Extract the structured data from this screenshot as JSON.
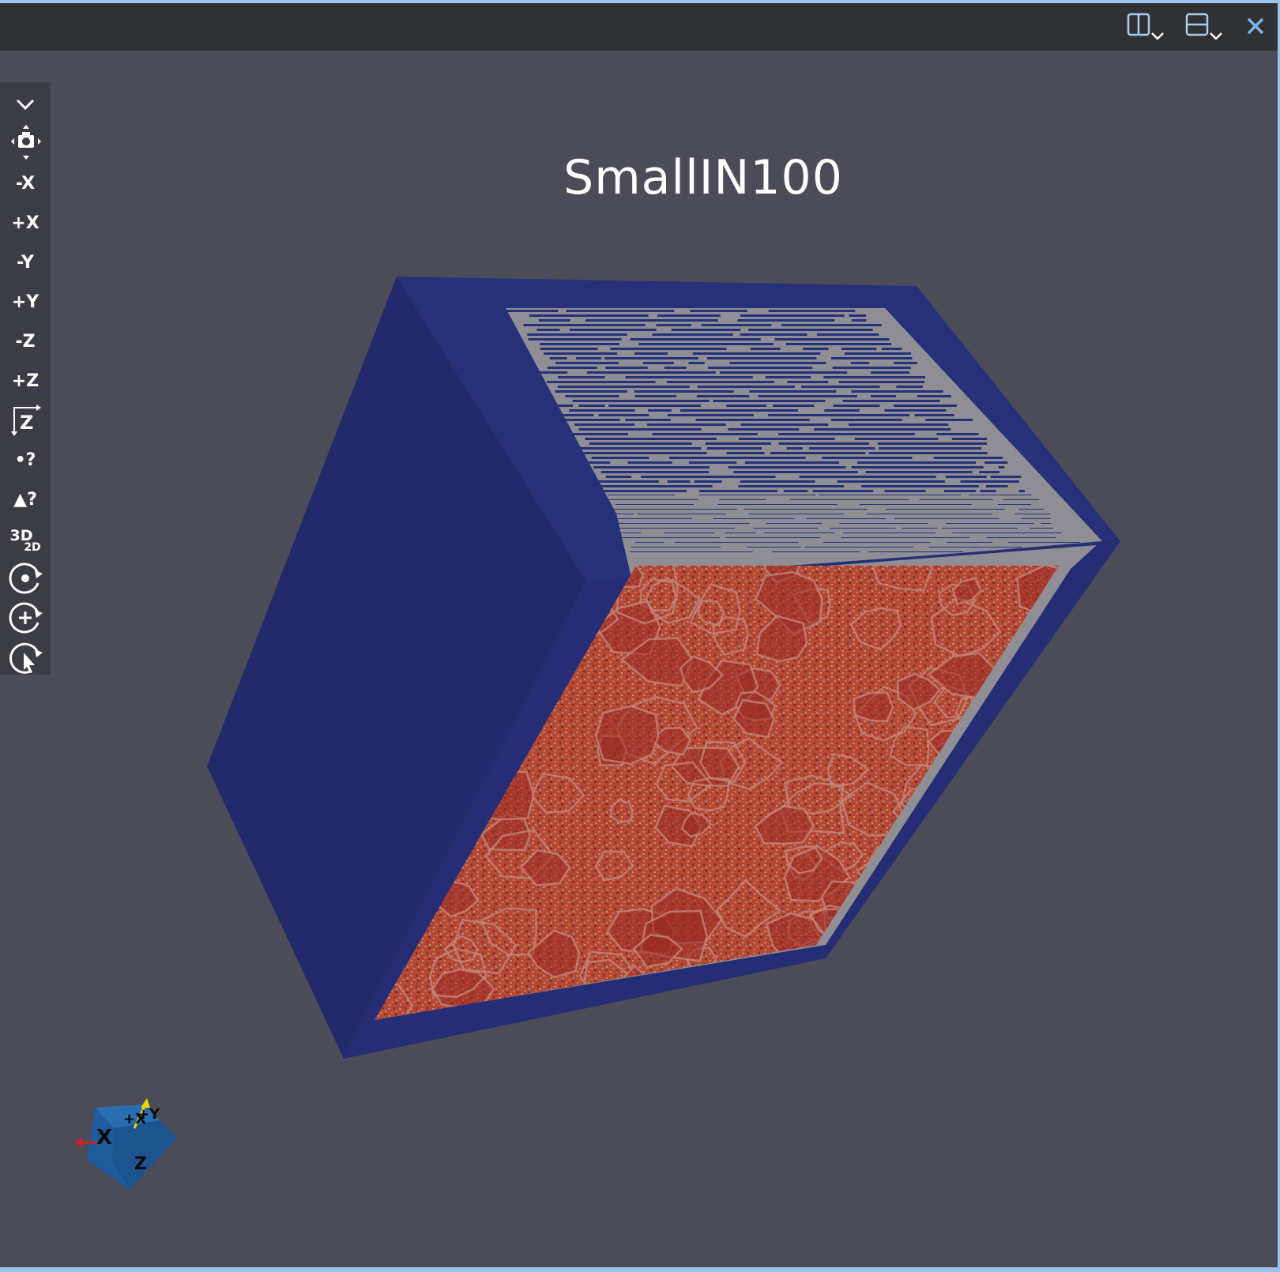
{
  "window": {
    "buttons": [
      {
        "name": "split-horizontal",
        "icon": "split-horizontal-icon"
      },
      {
        "name": "split-vertical",
        "icon": "split-vertical-icon"
      },
      {
        "name": "close",
        "icon": "close-icon",
        "label": "×"
      }
    ]
  },
  "toolbar": {
    "collapse_icon": "chevron-down-icon",
    "camera_icon": "camera-reset-icon",
    "view_minus_x": "-X",
    "view_plus_x": "+X",
    "view_minus_y": "-Y",
    "view_plus_y": "+Y",
    "view_minus_z": "-Z",
    "view_plus_z": "+Z",
    "rotate_z_icon": "rotate-z-icon",
    "rotate_z_label": "Z",
    "select_points_label": "•?",
    "select_cells_label": "▲?",
    "projection_3d": "3D",
    "projection_2d": "2D",
    "center_icon": "center-rotation-icon",
    "add_rotation_icon": "add-rotation-icon",
    "pick_rotation_icon": "pick-rotation-icon"
  },
  "view": {
    "title": "SmallIN100"
  },
  "colors": {
    "background": "#4b4c58",
    "titlebar": "#2f3133",
    "accent": "#9cc3ee",
    "volume_blue": "#243073",
    "volume_gray": "#8e8e94",
    "grain_red": "#b04a3a"
  },
  "orientation_axes": {
    "labels": [
      "X",
      "+X",
      "+Y",
      "Z"
    ],
    "icon": "orientation-cube-icon"
  }
}
